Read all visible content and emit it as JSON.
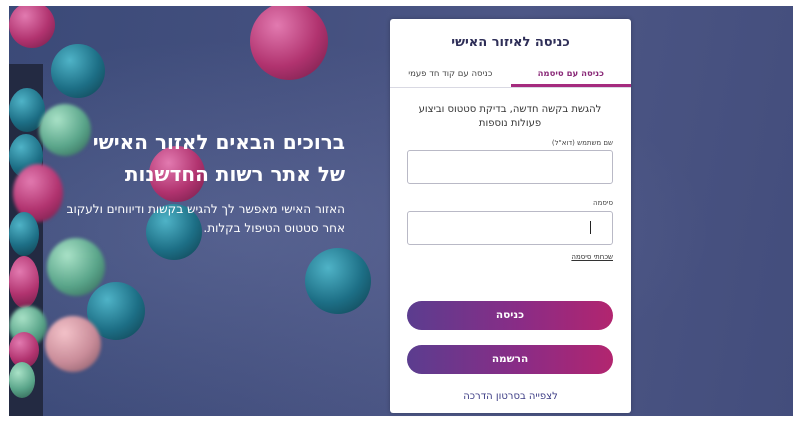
{
  "hero": {
    "title_line1": "ברוכים הבאים לאזור האישי",
    "title_line2": "של אתר רשות החדשנות",
    "subtitle": "האזור האישי מאפשר לך להגיש בקשות ודיווחים ולעקוב אחר סטטוס הטיפול בקלות."
  },
  "login": {
    "title": "כניסה לאיזור האישי",
    "tabs": [
      {
        "label": "כניסה עם סיסמה",
        "active": true
      },
      {
        "label": "כניסה עם קוד חד פעמי",
        "active": false
      }
    ],
    "intro": "להגשת בקשה חדשה, בדיקת סטטוס וביצוע פעולות נוספות",
    "username_label": "שם משתמש (דוא\"ל)",
    "username_value": "",
    "password_label": "סיסמה",
    "password_value": "",
    "forgot_password": "שכחתי סיסמה",
    "login_button": "כניסה",
    "register_button": "הרשמה",
    "video_link": "לצפייה בסרטון הדרכה"
  },
  "colors": {
    "accent": "#a52b7e",
    "button_gradient_start": "#5b3d8f",
    "button_gradient_end": "#b2256f",
    "hero_background": "#44507f",
    "title_text": "#2f2f58"
  }
}
